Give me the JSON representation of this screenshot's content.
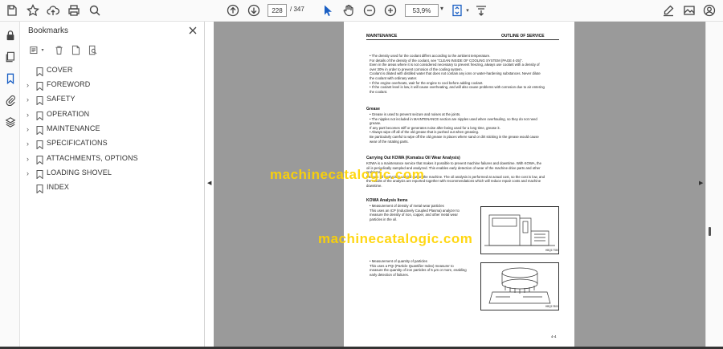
{
  "toolbar": {
    "page_current": "228",
    "page_total": "/ 347",
    "zoom": "53,9%"
  },
  "rail": {
    "icons": [
      "lock-icon",
      "pages-icon",
      "bookmark-icon",
      "attachment-icon",
      "layers-icon"
    ]
  },
  "bookmarks": {
    "title": "Bookmarks",
    "items": [
      {
        "label": "COVER",
        "expandable": false
      },
      {
        "label": "FOREWORD",
        "expandable": true
      },
      {
        "label": "SAFETY",
        "expandable": true
      },
      {
        "label": "OPERATION",
        "expandable": true
      },
      {
        "label": "MAINTENANCE",
        "expandable": true
      },
      {
        "label": "SPECIFICATIONS",
        "expandable": true
      },
      {
        "label": "ATTACHMENTS, OPTIONS",
        "expandable": true
      },
      {
        "label": "LOADING SHOVEL",
        "expandable": true
      },
      {
        "label": "INDEX",
        "expandable": false
      }
    ]
  },
  "document": {
    "header_left": "MAINTENANCE",
    "header_right": "OUTLINE OF SERVICE",
    "coolant": [
      "• The density used for the coolant differs according to the ambient temperature.",
      "  For details of the density of the coolant, see \"CLEAN INSIDE OF COOLING SYSTEM (PAGE 4-25)\".",
      "  Even in the areas where it is not considered necessary to prevent freezing, always use coolant with a density of",
      "  over 30% in order to prevent corrosion of the cooling system.",
      "  Coolant is diluted with distilled water that does not contain any ions or water-hardening substances. Never dilute",
      "  the coolant with ordinary water.",
      "• If the engine overheats, wait for the engine to cool before adding coolant.",
      "• If the coolant level is low, it will cause overheating, and will also cause problems with corrosion due to air entering",
      "  the coolant."
    ],
    "grease_heading": "Grease",
    "grease": [
      "• Grease is used to prevent seizure and noises at the joints.",
      "• The nipples not included in MAINTENANCE section are nipples used when overhauling, so they do not need",
      "  grease.",
      "  If any part becomes stiff or generates noise after being used for a long time, grease it.",
      "• Always wipe off all of the old grease that is pushed out when greasing.",
      "  Be particularly careful to wipe off the old grease in places where sand or dirt sticking in the grease would cause",
      "  wear of the rotating parts."
    ],
    "kowa_heading": "Carrying Out KOWA (Komatsu Oil Wear Analysis)",
    "kowa": [
      "KOWA is a maintenance service that makes it possible to prevent machine failures and downtime. With KOWA, the",
      "oil is periodically sampled and analyzed. This enables early detection of wear of the machine drive parts and other",
      "problems.",
      "Periodic oil analysis is carried out on the machine. The oil analysis is performed at actual cost, so the cost is low, and",
      "the results of the analysis are reported together with recommendations which will reduce repair costs and machine",
      "downtime."
    ],
    "items_heading": "KOWA Analysis Items",
    "item1": [
      "• Measurement of density of metal wear particles",
      "  This uses an ICP (Inductively Coupled Plasma) analyzer to",
      "  measure the density of iron, copper, and other metal wear",
      "  particles in the oil."
    ],
    "item2": [
      "• Measurement of quantity of particles",
      "  This uses a PQI (Particle Quantifier Index) measurer to",
      "  measure the quantity of iron particles of 5 µm or more, enabling",
      "  early detection of failures."
    ],
    "fig1_caption": "HBQ17780",
    "fig2_caption": "HBQ17800",
    "page_number": "4-4",
    "watermark_top": "machinecatalogic.com",
    "watermark_bottom": "machinecatalogic.com"
  }
}
